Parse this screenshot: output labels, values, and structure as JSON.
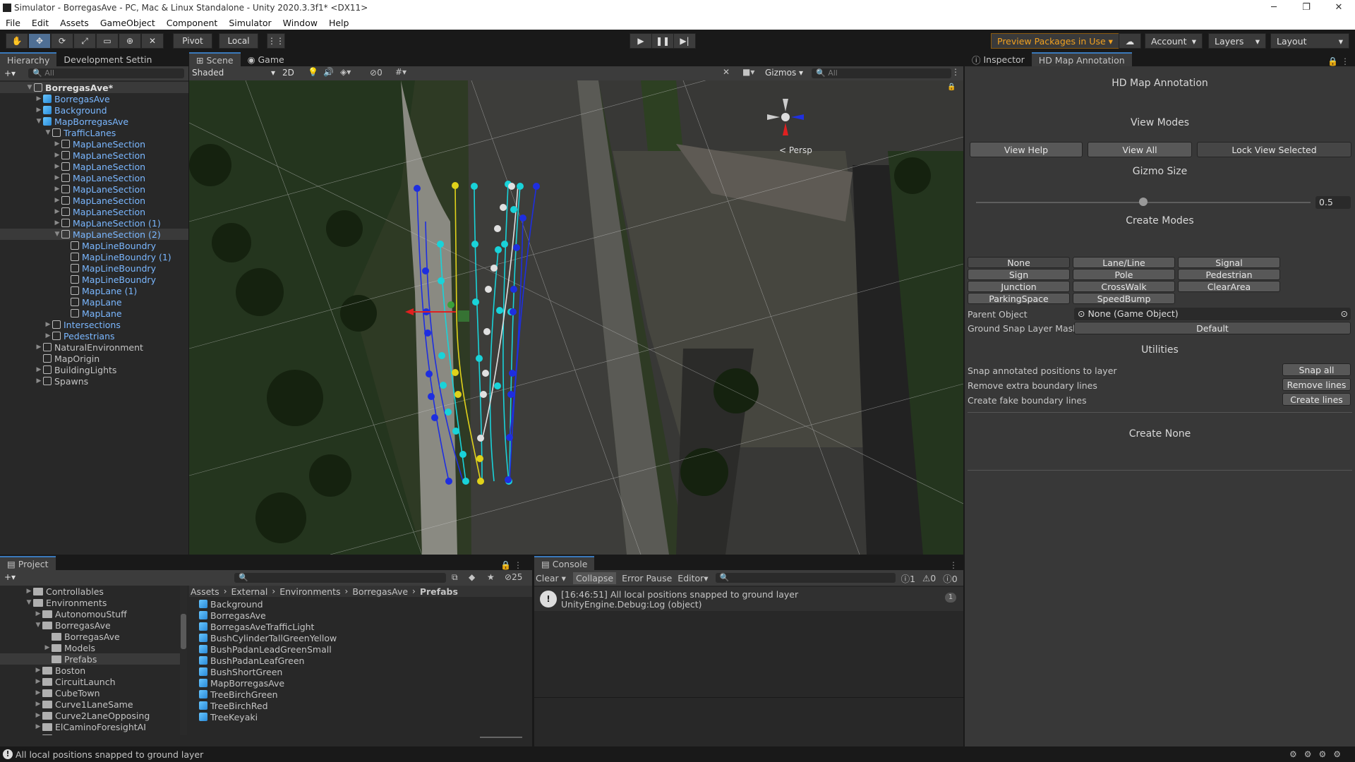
{
  "window": {
    "title": "Simulator - BorregasAve - PC, Mac & Linux Standalone - Unity 2020.3.3f1* <DX11>",
    "min": "─",
    "max": "❐",
    "close": "✕"
  },
  "menu": [
    "File",
    "Edit",
    "Assets",
    "GameObject",
    "Component",
    "Simulator",
    "Window",
    "Help"
  ],
  "toolbar": {
    "pivot": "Pivot",
    "local": "Local",
    "preview": "Preview Packages in Use",
    "account": "Account",
    "layers": "Layers",
    "layout": "Layout"
  },
  "hierarchy": {
    "tab1": "Hierarchy",
    "tab2": "Development Settin",
    "search": "All",
    "rows": [
      {
        "label": "BorregasAve*",
        "indent": 0,
        "arrow": "▼",
        "icon": "unity",
        "color": "bold"
      },
      {
        "label": "BorregasAve",
        "indent": 1,
        "arrow": "▶",
        "icon": "cube",
        "color": "blue"
      },
      {
        "label": "Background",
        "indent": 1,
        "arrow": "▶",
        "icon": "cube",
        "color": "blue"
      },
      {
        "label": "MapBorregasAve",
        "indent": 1,
        "arrow": "▼",
        "icon": "cube",
        "color": "blue"
      },
      {
        "label": "TrafficLanes",
        "indent": 2,
        "arrow": "▼",
        "icon": "wcube",
        "color": "blue"
      },
      {
        "label": "MapLaneSection",
        "indent": 3,
        "arrow": "▶",
        "icon": "wcube",
        "color": "blue"
      },
      {
        "label": "MapLaneSection",
        "indent": 3,
        "arrow": "▶",
        "icon": "wcube",
        "color": "blue"
      },
      {
        "label": "MapLaneSection",
        "indent": 3,
        "arrow": "▶",
        "icon": "wcube",
        "color": "blue"
      },
      {
        "label": "MapLaneSection",
        "indent": 3,
        "arrow": "▶",
        "icon": "wcube",
        "color": "blue"
      },
      {
        "label": "MapLaneSection",
        "indent": 3,
        "arrow": "▶",
        "icon": "wcube",
        "color": "blue"
      },
      {
        "label": "MapLaneSection",
        "indent": 3,
        "arrow": "▶",
        "icon": "wcube",
        "color": "blue"
      },
      {
        "label": "MapLaneSection",
        "indent": 3,
        "arrow": "▶",
        "icon": "wcube",
        "color": "blue"
      },
      {
        "label": "MapLaneSection (1)",
        "indent": 3,
        "arrow": "▶",
        "icon": "wcube",
        "color": "blue"
      },
      {
        "label": "MapLaneSection (2)",
        "indent": 3,
        "arrow": "▼",
        "icon": "wcube",
        "color": "blue"
      },
      {
        "label": "MapLineBoundry",
        "indent": 4,
        "arrow": "",
        "icon": "wcube",
        "color": "blue"
      },
      {
        "label": "MapLineBoundry (1)",
        "indent": 4,
        "arrow": "",
        "icon": "wcube",
        "color": "blue"
      },
      {
        "label": "MapLineBoundry",
        "indent": 4,
        "arrow": "",
        "icon": "wcube",
        "color": "blue"
      },
      {
        "label": "MapLineBoundry",
        "indent": 4,
        "arrow": "",
        "icon": "wcube",
        "color": "blue"
      },
      {
        "label": "MapLane (1)",
        "indent": 4,
        "arrow": "",
        "icon": "wcube",
        "color": "blue"
      },
      {
        "label": "MapLane",
        "indent": 4,
        "arrow": "",
        "icon": "wcube",
        "color": "blue"
      },
      {
        "label": "MapLane",
        "indent": 4,
        "arrow": "",
        "icon": "wcube",
        "color": "blue"
      },
      {
        "label": "Intersections",
        "indent": 2,
        "arrow": "▶",
        "icon": "wcube",
        "color": "blue"
      },
      {
        "label": "Pedestrians",
        "indent": 2,
        "arrow": "▶",
        "icon": "wcube",
        "color": "blue"
      },
      {
        "label": "NaturalEnvironment",
        "indent": 1,
        "arrow": "▶",
        "icon": "wcube",
        "color": "plain"
      },
      {
        "label": "MapOrigin",
        "indent": 1,
        "arrow": "",
        "icon": "wcube",
        "color": "plain"
      },
      {
        "label": "BuildingLights",
        "indent": 1,
        "arrow": "▶",
        "icon": "wcube",
        "color": "plain"
      },
      {
        "label": "Spawns",
        "indent": 1,
        "arrow": "▶",
        "icon": "wcube",
        "color": "plain"
      }
    ]
  },
  "scene": {
    "tab1": "Scene",
    "tab2": "Game",
    "shading": "Shaded",
    "mode2d": "2D",
    "hidden_count": "0",
    "gizmos": "Gizmos",
    "search": "All",
    "persp": "< Persp"
  },
  "inspector": {
    "tab1": "Inspector",
    "tab2": "HD Map Annotation",
    "header": "HD Map Annotation",
    "view_modes": "View Modes",
    "view_help": "View Help",
    "view_all": "View All",
    "lock_view": "Lock View Selected",
    "gizmo_size": "Gizmo Size",
    "gizmo_value": "0.5",
    "gizmo_fraction": 0.5,
    "create_modes": "Create Modes",
    "modes": [
      "None",
      "Lane/Line",
      "Signal",
      "Sign",
      "Pole",
      "Pedestrian",
      "Junction",
      "CrossWalk",
      "ClearArea",
      "ParkingSpace",
      "SpeedBump"
    ],
    "parent_label": "Parent Object",
    "parent_value": "None (Game Object)",
    "snap_label": "Ground Snap Layer Mask",
    "snap_value": "Default",
    "utilities": "Utilities",
    "util_rows": [
      {
        "label": "Snap annotated positions to layer",
        "btn": "Snap all"
      },
      {
        "label": "Remove extra boundary lines",
        "btn": "Remove lines"
      },
      {
        "label": "Create fake boundary lines",
        "btn": "Create lines"
      }
    ],
    "create_none": "Create None"
  },
  "project": {
    "tab": "Project",
    "hidden_count": "25",
    "tree": [
      {
        "label": "Controllables",
        "indent": 1,
        "arrow": "▶"
      },
      {
        "label": "Environments",
        "indent": 1,
        "arrow": "▼"
      },
      {
        "label": "AutonomouStuff",
        "indent": 2,
        "arrow": "▶"
      },
      {
        "label": "BorregasAve",
        "indent": 2,
        "arrow": "▼"
      },
      {
        "label": "BorregasAve",
        "indent": 3,
        "arrow": ""
      },
      {
        "label": "Models",
        "indent": 3,
        "arrow": "▶"
      },
      {
        "label": "Prefabs",
        "indent": 3,
        "arrow": ""
      },
      {
        "label": "Boston",
        "indent": 2,
        "arrow": "▶"
      },
      {
        "label": "CircuitLaunch",
        "indent": 2,
        "arrow": "▶"
      },
      {
        "label": "CubeTown",
        "indent": 2,
        "arrow": "▶"
      },
      {
        "label": "Curve1LaneSame",
        "indent": 2,
        "arrow": "▶"
      },
      {
        "label": "Curve2LaneOpposing",
        "indent": 2,
        "arrow": "▶"
      },
      {
        "label": "ElCaminoForesightAI",
        "indent": 2,
        "arrow": "▶"
      },
      {
        "label": "GoMentum",
        "indent": 2,
        "arrow": "▶"
      }
    ],
    "breadcrumb": [
      "Assets",
      "External",
      "Environments",
      "BorregasAve",
      "Prefabs"
    ],
    "assets": [
      "Background",
      "BorregasAve",
      "BorregasAveTrafficLight",
      "BushCylinderTallGreenYellow",
      "BushPadanLeadGreenSmall",
      "BushPadanLeafGreen",
      "BushShortGreen",
      "MapBorregasAve",
      "TreeBirchGreen",
      "TreeBirchRed",
      "TreeKeyaki"
    ]
  },
  "console": {
    "tab": "Console",
    "clear": "Clear",
    "collapse": "Collapse",
    "error_pause": "Error Pause",
    "editor": "Editor",
    "count_log": "1",
    "count_warn": "0",
    "count_err": "0",
    "msg1": "[16:46:51] All local positions snapped to ground layer",
    "msg2": "UnityEngine.Debug:Log (object)",
    "msg_count": "1"
  },
  "status": {
    "text": "All local positions snapped to ground layer"
  },
  "colors": {
    "accent": "#3a79bb",
    "preview": "#f0a020",
    "lane_blue": "#1e2ee0",
    "lane_cyan": "#19d3d9",
    "lane_yellow": "#e0d21a",
    "lane_white": "#e0e0e0"
  }
}
